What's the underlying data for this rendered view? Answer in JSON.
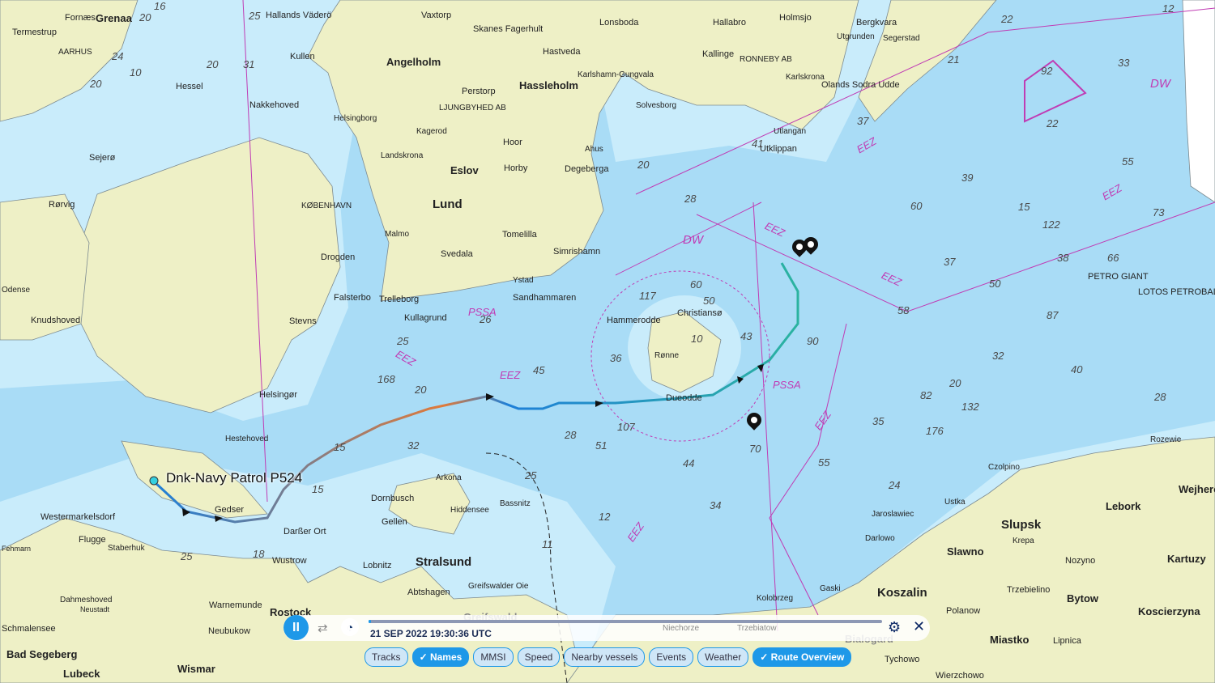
{
  "map": {
    "colors": {
      "sea": "#a9dcf6",
      "shallow": "#c9ecfb",
      "land": "#eef0c6",
      "zone": "#c03cb4",
      "track_start": "#1e7fd8",
      "track_end": "#2bb3a0"
    },
    "vessel": {
      "name": "Dnk-Navy Patrol P524",
      "icon": "vessel-position-icon"
    },
    "places": [
      "Termestrup",
      "Fornæs",
      "Grenaa",
      "AARHUS",
      "Hessel",
      "Sejerø",
      "Rørvig",
      "Nakkehoved",
      "Helsingborg",
      "Hallands Väderö",
      "Kullen",
      "Angelholm",
      "Vaxtorp",
      "Skanes Fagerhult",
      "Hastveda",
      "Lonsboda",
      "Hallabro",
      "Holmsjo",
      "Bergkvara",
      "Utgrunden",
      "Segerstad",
      "Hassleholm",
      "Perstorp",
      "LJUNGBYHED AB",
      "Kagerod",
      "Landskrona",
      "Eslov",
      "Hoor",
      "Horby",
      "Degeberga",
      "Ahus",
      "Lund",
      "KØBENHAVN",
      "Malmo",
      "Svedala",
      "Tomelilla",
      "Simrishamn",
      "Ystad",
      "Sandhammaren",
      "Trelleborg",
      "Kullagrund",
      "Falsterbo",
      "Drogden",
      "Stevns",
      "Odense",
      "Knudshoved",
      "Helsingør",
      "Hammerodde",
      "Christiansø",
      "Rønne",
      "Dueodde",
      "Karlshamn-Gungvala",
      "Kallinge",
      "RONNEBY AB",
      "Karlskrona",
      "Olands Sodra Udde",
      "Solvesborg",
      "Utlangan",
      "Utklippan",
      "Gedser",
      "Hestehoved",
      "Westermarkelsdorf",
      "Flugge",
      "Staberhuk",
      "Dahmeshoved",
      "Neustadt",
      "Schmalensee",
      "Bad Segeberg",
      "Lubeck",
      "Wismar",
      "Warnemunde",
      "Rostock",
      "Neubukow",
      "Darßer Ort",
      "Wustrow",
      "Dornbusch",
      "Arkona",
      "Hiddensee",
      "Gellen",
      "Stralsund",
      "Lobnitz",
      "Greifswalder Oie",
      "Abtshagen",
      "Greifswald",
      "Bassnitz",
      "Niechorze",
      "Trzebiatow",
      "Kolobrzeg",
      "Koszalin",
      "Bialogard",
      "Tychowo",
      "Darlowo",
      "Jaroslawiec",
      "Ustka",
      "Slupsk",
      "Krepa",
      "Slawno",
      "Lebork",
      "Czolpino",
      "Rozewie",
      "Wejherowo",
      "Kartuzy",
      "Bytow",
      "Koscierzyna",
      "Miastko",
      "Lipnica",
      "Polanow",
      "Trzebielino",
      "Nozyno",
      "Wierzchowo",
      "Gaski",
      "PETRO GIANT",
      "LOTOS PETROBALTIC",
      "Fehmarn"
    ],
    "depths": [
      "16",
      "25",
      "20",
      "24",
      "20",
      "31",
      "10",
      "20",
      "37",
      "41",
      "21",
      "22",
      "12",
      "92",
      "22",
      "55",
      "33",
      "73",
      "20",
      "39",
      "60",
      "15",
      "122",
      "37",
      "66",
      "38",
      "28",
      "58",
      "87",
      "50",
      "60",
      "43",
      "50",
      "90",
      "32",
      "40",
      "20",
      "82",
      "132",
      "176",
      "28",
      "35",
      "55",
      "70",
      "44",
      "34",
      "24",
      "12",
      "11",
      "107",
      "51",
      "28",
      "25",
      "45",
      "168",
      "25",
      "26",
      "117",
      "36",
      "10",
      "32",
      "18",
      "25",
      "20",
      "15",
      "15"
    ],
    "zones": [
      "PSSA",
      "PSSA",
      "EEZ",
      "EEZ",
      "EEZ",
      "EEZ",
      "EEZ",
      "EEZ",
      "EEZ",
      "EEZ",
      "DW",
      "DW"
    ]
  },
  "playback": {
    "pause_label": "II",
    "timestamp": "21 SEP 2022 19:30:36 UTC",
    "progress_percent": 0.5,
    "icons": {
      "pause": "pause-icon",
      "swap": "swap-icon",
      "speed": "speedometer-icon",
      "settings": "gear-icon",
      "close": "close-icon"
    }
  },
  "toggles": [
    {
      "label": "Tracks",
      "active": false
    },
    {
      "label": "Names",
      "active": true
    },
    {
      "label": "MMSI",
      "active": false
    },
    {
      "label": "Speed",
      "active": false
    },
    {
      "label": "Nearby vessels",
      "active": false
    },
    {
      "label": "Events",
      "active": false
    },
    {
      "label": "Weather",
      "active": false
    },
    {
      "label": "Route Overview",
      "active": true
    }
  ]
}
